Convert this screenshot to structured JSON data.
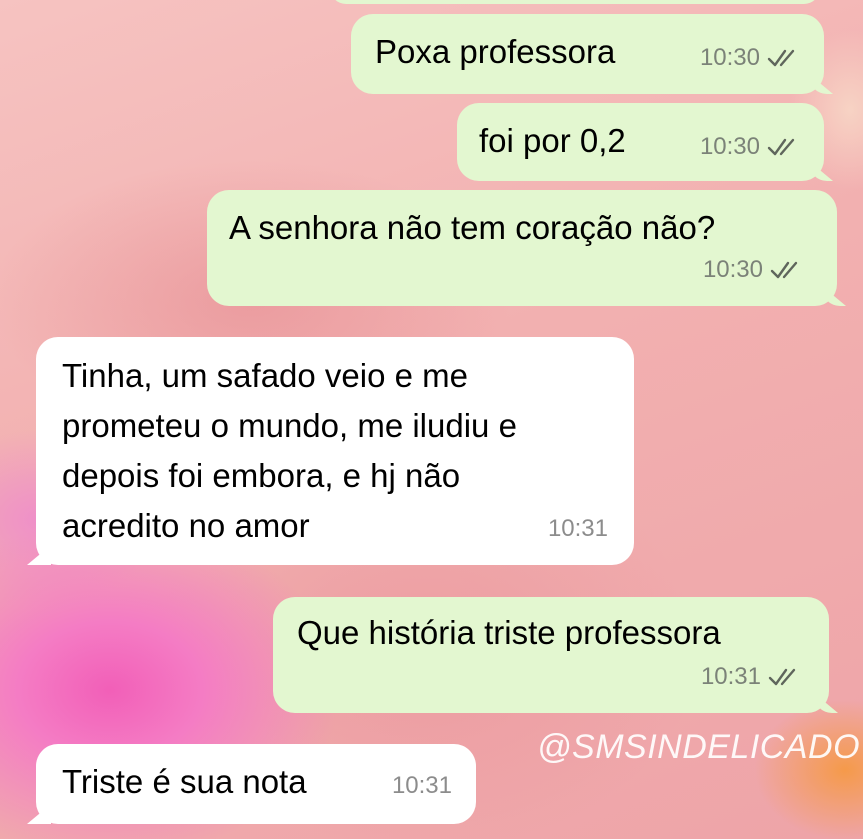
{
  "chat": {
    "messages": [
      {
        "direction": "outgoing",
        "text": "Poxa professora",
        "time": "10:30",
        "status": "read"
      },
      {
        "direction": "outgoing",
        "text": "foi por 0,2",
        "time": "10:30",
        "status": "read"
      },
      {
        "direction": "outgoing",
        "text": "A senhora não tem coração não?",
        "time": "10:30",
        "status": "read"
      },
      {
        "direction": "incoming",
        "text": "Tinha, um safado veio e me\nprometeu o mundo, me iludiu e\ndepois foi embora, e hj não\nacredito no amor",
        "time": "10:31"
      },
      {
        "direction": "outgoing",
        "text": "Que história triste professora",
        "time": "10:31",
        "status": "read"
      },
      {
        "direction": "incoming",
        "text": "Triste é sua nota",
        "time": "10:31"
      }
    ]
  },
  "watermark": "@SMSINDELICADO",
  "icons": {
    "read_receipt": "double-check-icon"
  },
  "colors": {
    "outgoing_bubble": "#e3f7d0",
    "incoming_bubble": "#ffffff",
    "check": "#5f665c"
  }
}
